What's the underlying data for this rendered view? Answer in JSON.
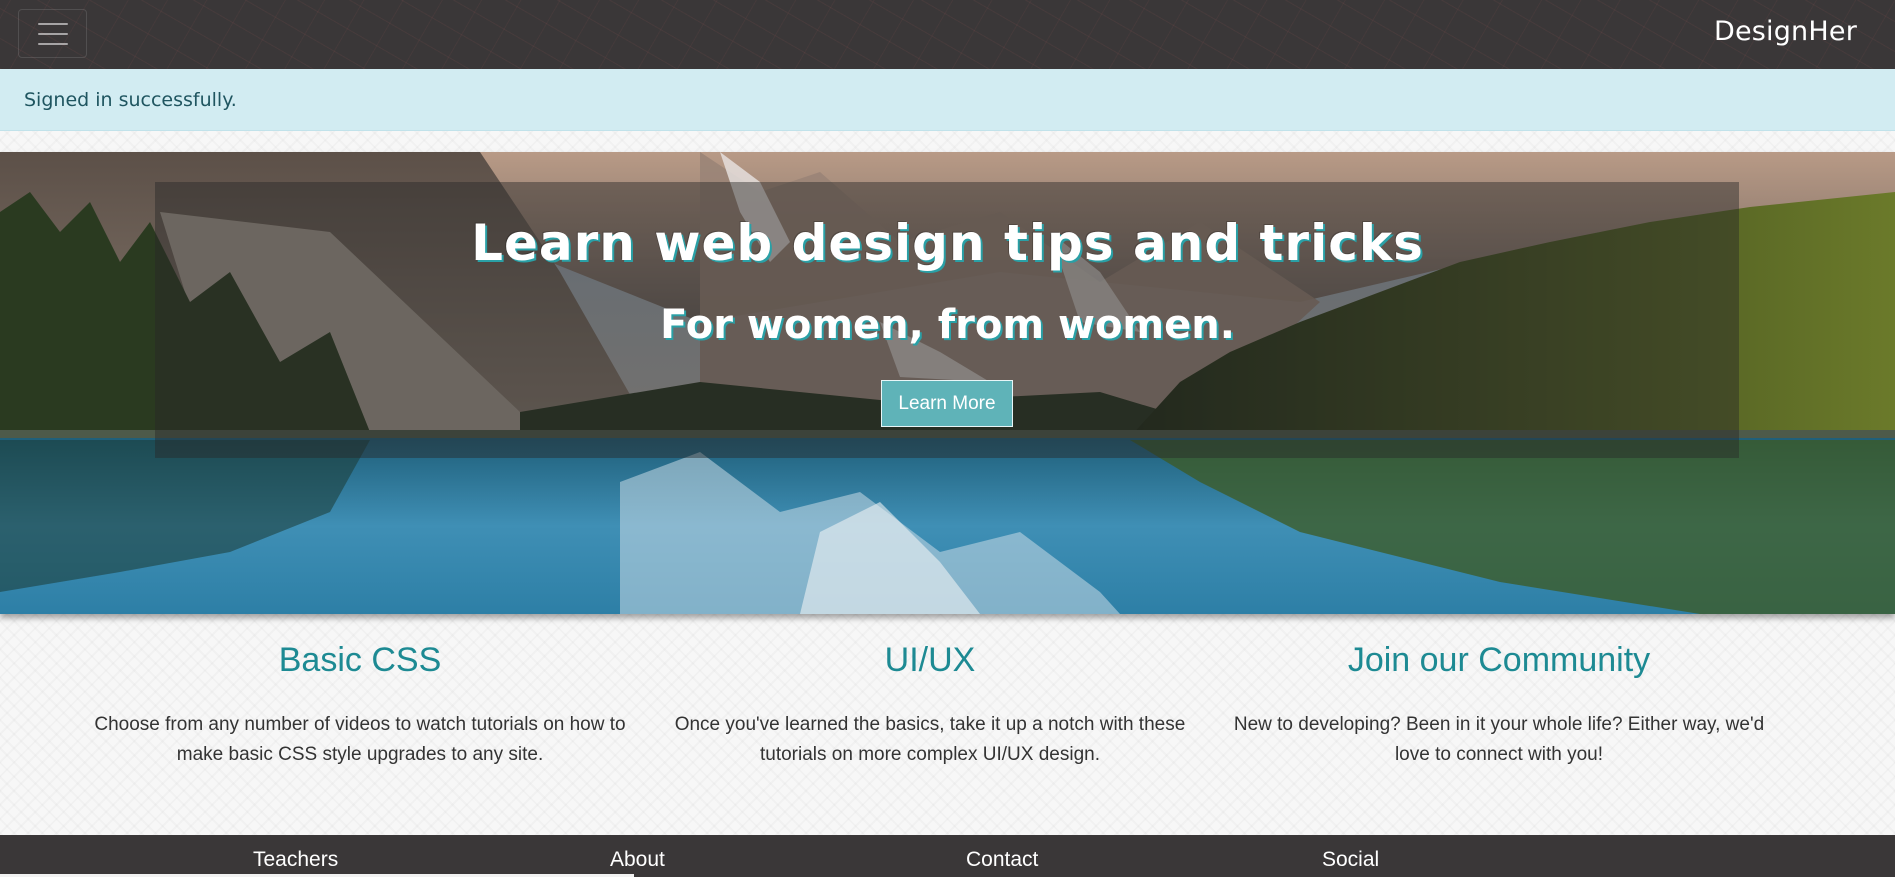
{
  "navbar": {
    "menu_icon": "hamburger-icon",
    "brand": "DesignHer"
  },
  "alert": {
    "message": "Signed in successfully."
  },
  "hero": {
    "title": "Learn web design tips and tricks",
    "subtitle": "For women, from women.",
    "cta_label": "Learn More"
  },
  "features": [
    {
      "title": "Basic CSS",
      "text": "Choose from any number of videos to watch tutorials on how to make basic CSS style upgrades to any site."
    },
    {
      "title": "UI/UX",
      "text": "Once you've learned the basics, take it up a notch with these tutorials on more complex UI/UX design."
    },
    {
      "title": "Join our Community",
      "text": "New to developing? Been in it your whole life? Either way, we'd love to connect with you!"
    }
  ],
  "footer": {
    "links": [
      "Teachers",
      "About",
      "Contact",
      "Social"
    ]
  },
  "colors": {
    "navbar_bg": "#3a3738",
    "alert_bg": "#d2ecf2",
    "accent_teal": "#1d8a93",
    "button_bg": "#5fb3b8"
  }
}
